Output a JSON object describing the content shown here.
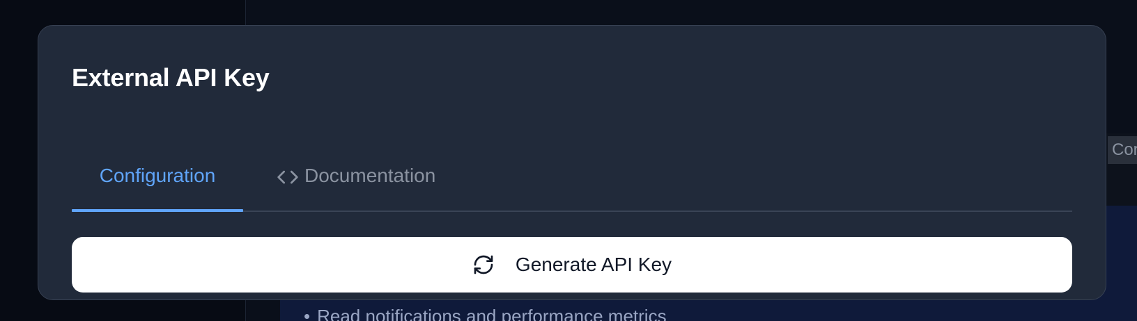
{
  "modal": {
    "title": "External API Key",
    "tabs": [
      {
        "label": "Configuration",
        "icon": "",
        "active": true
      },
      {
        "label": "Documentation",
        "icon": "code-icon",
        "active": false
      }
    ],
    "generate_button": {
      "label": "Generate API Key",
      "icon": "refresh-icon"
    }
  },
  "background": {
    "chip_text": "Cor",
    "bullet_text": "Read notifications and performance metrics"
  },
  "colors": {
    "accent": "#60a5fa",
    "modal_bg": "#212a3a",
    "page_bg": "#0a0f1a",
    "button_bg": "#ffffff",
    "muted_text": "#8b93a1"
  }
}
